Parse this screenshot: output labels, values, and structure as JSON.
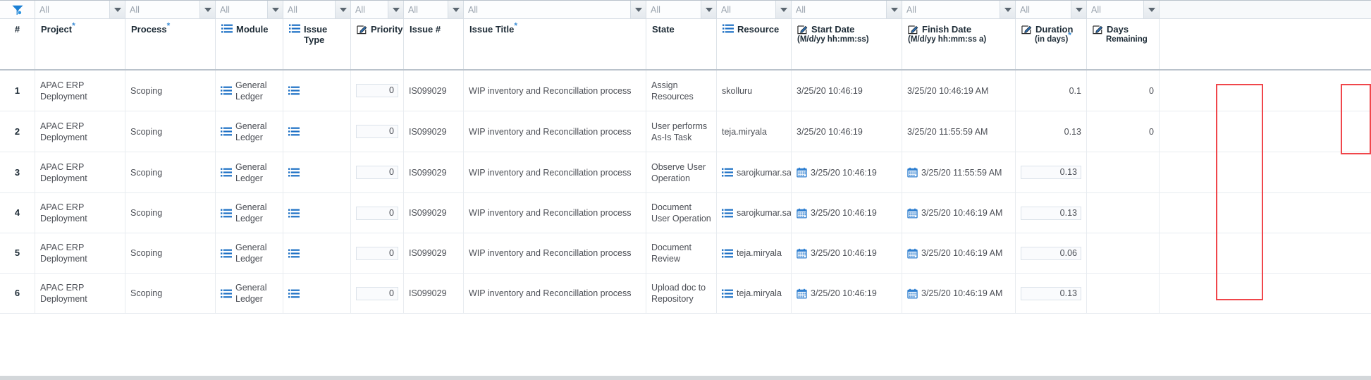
{
  "filter_row": {
    "funnel_icon": "filter-funnel-icon",
    "placeholder": "All",
    "cells": [
      {
        "value": "All"
      },
      {
        "value": "All"
      },
      {
        "value": "All"
      },
      {
        "value": "All"
      },
      {
        "value": "All"
      },
      {
        "value": "All"
      },
      {
        "value": "All"
      },
      {
        "value": "All"
      },
      {
        "value": "All"
      },
      {
        "value": "All"
      },
      {
        "value": "All"
      },
      {
        "value": "All"
      },
      {
        "value": "All"
      }
    ]
  },
  "columns": [
    {
      "key": "num",
      "label": "#",
      "sub": "",
      "icon": "",
      "required": false
    },
    {
      "key": "project",
      "label": "Project",
      "sub": "",
      "icon": "",
      "required": true
    },
    {
      "key": "process",
      "label": "Process",
      "sub": "",
      "icon": "",
      "required": true
    },
    {
      "key": "module",
      "label": "Module",
      "sub": "",
      "icon": "list-icon",
      "required": false
    },
    {
      "key": "issue_type",
      "label": "Issue Type",
      "sub": "",
      "icon": "list-icon",
      "required": false
    },
    {
      "key": "priority",
      "label": "Priority",
      "sub": "",
      "icon": "edit-icon",
      "required": false
    },
    {
      "key": "issue_no",
      "label": "Issue #",
      "sub": "",
      "icon": "",
      "required": false
    },
    {
      "key": "issue_title",
      "label": "Issue Title",
      "sub": "",
      "icon": "",
      "required": true
    },
    {
      "key": "state",
      "label": "State",
      "sub": "",
      "icon": "",
      "required": false
    },
    {
      "key": "resource",
      "label": "Resource",
      "sub": "",
      "icon": "list-icon",
      "required": false
    },
    {
      "key": "start_date",
      "label": "Start Date",
      "sub": "(M/d/yy hh:mm:ss)",
      "icon": "edit-icon",
      "required": false
    },
    {
      "key": "finish_date",
      "label": "Finish Date",
      "sub": "(M/d/yy hh:mm:ss a)",
      "icon": "edit-icon",
      "required": false
    },
    {
      "key": "duration",
      "label": "Duration",
      "sub": "(in days)",
      "icon": "edit-icon",
      "required": true
    },
    {
      "key": "days_left",
      "label": "Days",
      "sub": "Remaining",
      "icon": "edit-icon",
      "required": false
    }
  ],
  "rows": [
    {
      "num": "1",
      "project": "APAC ERP Deployment",
      "process": "Scoping",
      "module": "General Ledger",
      "module_icon": "list-icon",
      "issue_type": "",
      "issue_type_icon": "list-icon",
      "priority": "0",
      "issue_no": "IS099029",
      "issue_title": "WIP inventory and Reconcillation process",
      "state": "Assign Resources",
      "resource": "skolluru",
      "resource_icon": "",
      "start_date": "3/25/20 10:46:19",
      "start_icon": "",
      "finish_date": "3/25/20 10:46:19 AM",
      "finish_icon": "",
      "duration": "0.1",
      "duration_boxed": false,
      "days_left": "0",
      "days_left_boxed": false
    },
    {
      "num": "2",
      "project": "APAC ERP Deployment",
      "process": "Scoping",
      "module": "General Ledger",
      "module_icon": "list-icon",
      "issue_type": "",
      "issue_type_icon": "list-icon",
      "priority": "0",
      "issue_no": "IS099029",
      "issue_title": "WIP inventory and Reconcillation process",
      "state": "User performs As-Is Task",
      "resource": "teja.miryala",
      "resource_icon": "",
      "start_date": "3/25/20 10:46:19",
      "start_icon": "",
      "finish_date": "3/25/20 11:55:59 AM",
      "finish_icon": "",
      "duration": "0.13",
      "duration_boxed": false,
      "days_left": "0",
      "days_left_boxed": false
    },
    {
      "num": "3",
      "project": "APAC ERP Deployment",
      "process": "Scoping",
      "module": "General Ledger",
      "module_icon": "list-icon",
      "issue_type": "",
      "issue_type_icon": "list-icon",
      "priority": "0",
      "issue_no": "IS099029",
      "issue_title": "WIP inventory and Reconcillation process",
      "state": "Observe User Operation",
      "resource": "sarojkumar.sahu",
      "resource_icon": "list-icon",
      "start_date": "3/25/20 10:46:19",
      "start_icon": "calendar-icon",
      "finish_date": "3/25/20 11:55:59 AM",
      "finish_icon": "calendar-icon",
      "duration": "0.13",
      "duration_boxed": true,
      "days_left": "",
      "days_left_boxed": false
    },
    {
      "num": "4",
      "project": "APAC ERP Deployment",
      "process": "Scoping",
      "module": "General Ledger",
      "module_icon": "list-icon",
      "issue_type": "",
      "issue_type_icon": "list-icon",
      "priority": "0",
      "issue_no": "IS099029",
      "issue_title": "WIP inventory and Reconcillation process",
      "state": "Document User Operation",
      "resource": "sarojkumar.sahu",
      "resource_icon": "list-icon",
      "start_date": "3/25/20 10:46:19",
      "start_icon": "calendar-icon",
      "finish_date": "3/25/20 10:46:19 AM",
      "finish_icon": "calendar-icon",
      "duration": "0.13",
      "duration_boxed": true,
      "days_left": "",
      "days_left_boxed": false
    },
    {
      "num": "5",
      "project": "APAC ERP Deployment",
      "process": "Scoping",
      "module": "General Ledger",
      "module_icon": "list-icon",
      "issue_type": "",
      "issue_type_icon": "list-icon",
      "priority": "0",
      "issue_no": "IS099029",
      "issue_title": "WIP inventory and Reconcillation process",
      "state": "Document Review",
      "resource": "teja.miryala",
      "resource_icon": "list-icon",
      "start_date": "3/25/20 10:46:19",
      "start_icon": "calendar-icon",
      "finish_date": "3/25/20 10:46:19 AM",
      "finish_icon": "calendar-icon",
      "duration": "0.06",
      "duration_boxed": true,
      "days_left": "",
      "days_left_boxed": false
    },
    {
      "num": "6",
      "project": "APAC ERP Deployment",
      "process": "Scoping",
      "module": "General Ledger",
      "module_icon": "list-icon",
      "issue_type": "",
      "issue_type_icon": "list-icon",
      "priority": "0",
      "issue_no": "IS099029",
      "issue_title": "WIP inventory and Reconcillation process",
      "state": "Upload doc to Repository",
      "resource": "teja.miryala",
      "resource_icon": "list-icon",
      "start_date": "3/25/20 10:46:19",
      "start_icon": "calendar-icon",
      "finish_date": "3/25/20 10:46:19 AM",
      "finish_icon": "calendar-icon",
      "duration": "0.13",
      "duration_boxed": true,
      "days_left": "",
      "days_left_boxed": false
    }
  ],
  "annotations": [
    {
      "name": "duration-highlight",
      "color": "#f0464b"
    },
    {
      "name": "days-remaining-highlight",
      "color": "#f0464b"
    }
  ]
}
